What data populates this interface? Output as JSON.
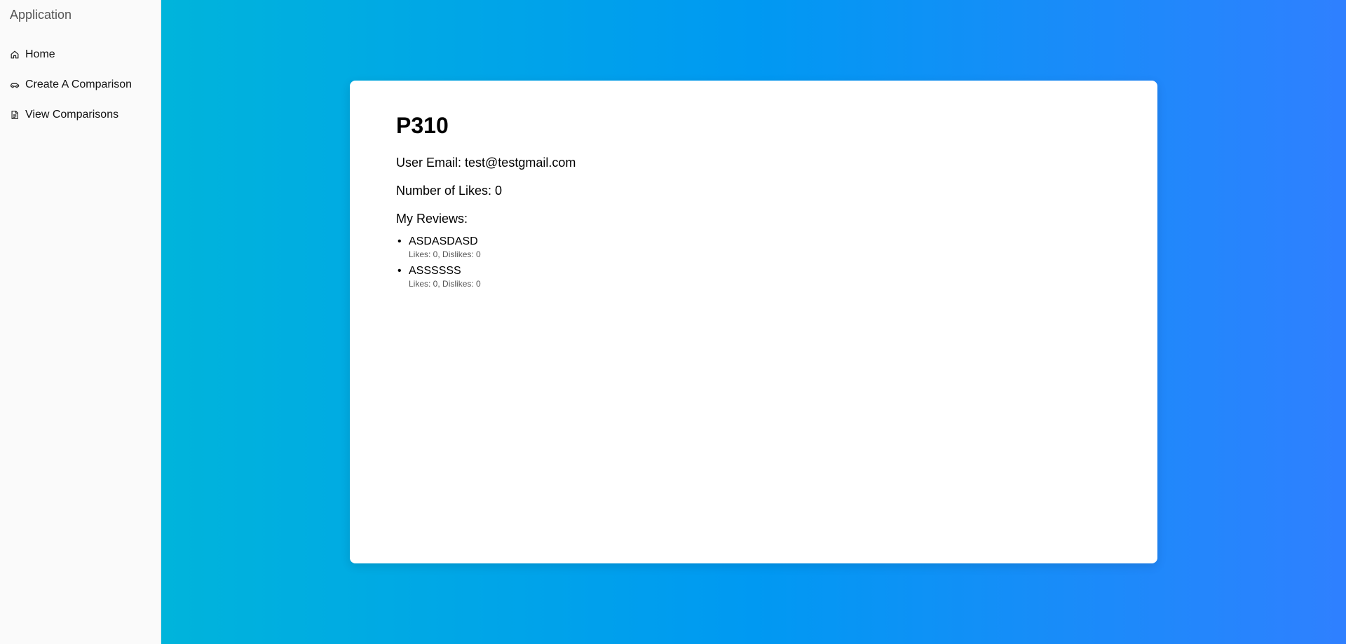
{
  "app": {
    "title": "Application"
  },
  "sidebar": {
    "items": [
      {
        "label": "Home",
        "icon": "home-icon"
      },
      {
        "label": "Create A Comparison",
        "icon": "car-icon"
      },
      {
        "label": "View Comparisons",
        "icon": "document-icon"
      }
    ]
  },
  "profile": {
    "name": "P310",
    "email_line": "User Email: test@testgmail.com",
    "likes_line": "Number of Likes: 0",
    "reviews_heading": "My Reviews:",
    "reviews": [
      {
        "text": "ASDASDASD",
        "stats": "Likes: 0, Dislikes: 0"
      },
      {
        "text": "ASSSSSS",
        "stats": "Likes: 0, Dislikes: 0"
      }
    ]
  },
  "colors": {
    "gradient_start": "#00b4db",
    "gradient_mid": "#0099f2",
    "gradient_end": "#2f80ff",
    "sidebar_bg": "#fafafa"
  }
}
